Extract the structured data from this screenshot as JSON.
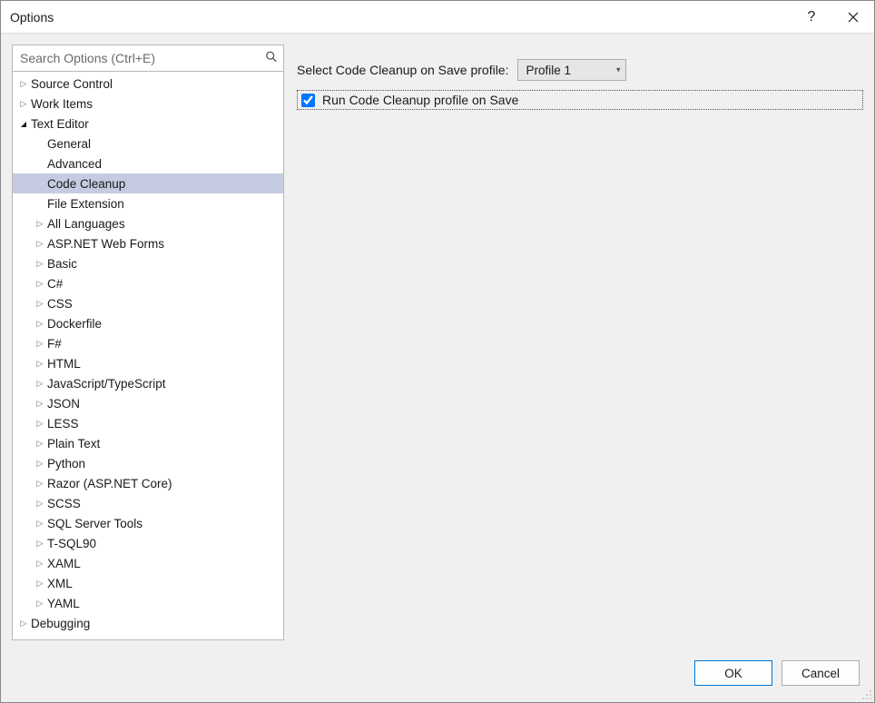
{
  "window": {
    "title": "Options",
    "help_glyph": "?",
    "close_tooltip": "Close"
  },
  "search": {
    "placeholder": "Search Options (Ctrl+E)"
  },
  "tree": [
    {
      "label": "Source Control",
      "depth": 0,
      "expander": "closed"
    },
    {
      "label": "Work Items",
      "depth": 0,
      "expander": "closed"
    },
    {
      "label": "Text Editor",
      "depth": 0,
      "expander": "open"
    },
    {
      "label": "General",
      "depth": 1,
      "expander": "none"
    },
    {
      "label": "Advanced",
      "depth": 1,
      "expander": "none"
    },
    {
      "label": "Code Cleanup",
      "depth": 1,
      "expander": "none",
      "selected": true
    },
    {
      "label": "File Extension",
      "depth": 1,
      "expander": "none"
    },
    {
      "label": "All Languages",
      "depth": 1,
      "expander": "closed"
    },
    {
      "label": "ASP.NET Web Forms",
      "depth": 1,
      "expander": "closed"
    },
    {
      "label": "Basic",
      "depth": 1,
      "expander": "closed"
    },
    {
      "label": "C#",
      "depth": 1,
      "expander": "closed"
    },
    {
      "label": "CSS",
      "depth": 1,
      "expander": "closed"
    },
    {
      "label": "Dockerfile",
      "depth": 1,
      "expander": "closed"
    },
    {
      "label": "F#",
      "depth": 1,
      "expander": "closed"
    },
    {
      "label": "HTML",
      "depth": 1,
      "expander": "closed"
    },
    {
      "label": "JavaScript/TypeScript",
      "depth": 1,
      "expander": "closed"
    },
    {
      "label": "JSON",
      "depth": 1,
      "expander": "closed"
    },
    {
      "label": "LESS",
      "depth": 1,
      "expander": "closed"
    },
    {
      "label": "Plain Text",
      "depth": 1,
      "expander": "closed"
    },
    {
      "label": "Python",
      "depth": 1,
      "expander": "closed"
    },
    {
      "label": "Razor (ASP.NET Core)",
      "depth": 1,
      "expander": "closed"
    },
    {
      "label": "SCSS",
      "depth": 1,
      "expander": "closed"
    },
    {
      "label": "SQL Server Tools",
      "depth": 1,
      "expander": "closed"
    },
    {
      "label": "T-SQL90",
      "depth": 1,
      "expander": "closed"
    },
    {
      "label": "XAML",
      "depth": 1,
      "expander": "closed"
    },
    {
      "label": "XML",
      "depth": 1,
      "expander": "closed"
    },
    {
      "label": "YAML",
      "depth": 1,
      "expander": "closed"
    },
    {
      "label": "Debugging",
      "depth": 0,
      "expander": "closed"
    }
  ],
  "main": {
    "profile_label": "Select Code Cleanup on Save profile:",
    "profile_value": "Profile 1",
    "checkbox_label": "Run Code Cleanup profile on Save",
    "checkbox_checked": true
  },
  "footer": {
    "ok": "OK",
    "cancel": "Cancel"
  }
}
